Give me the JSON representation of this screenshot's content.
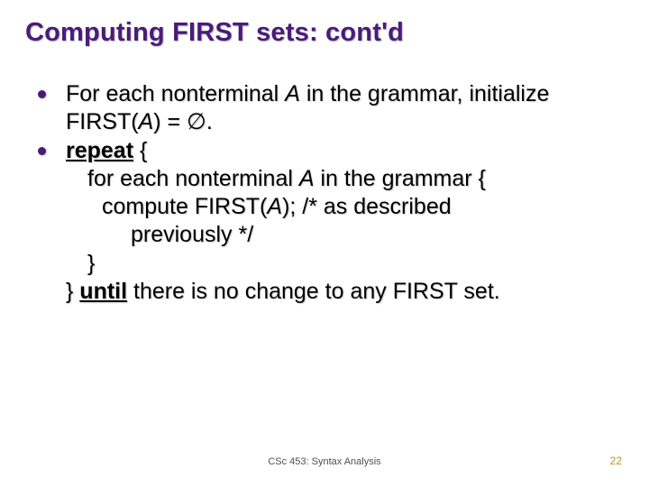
{
  "title": "Computing FIRST sets: cont'd",
  "b1": {
    "p1": "For each nonterminal ",
    "A1": "A",
    "p2": " in the grammar, initialize FIRST(",
    "A2": "A",
    "p3": ") = ∅."
  },
  "b2": {
    "repeat": "repeat",
    "brace_open": " {",
    "line_for_p1": "for each nonterminal ",
    "line_for_A": "A",
    "line_for_p2": " in the grammar {",
    "line_compute_p1": "compute FIRST(",
    "line_compute_A": "A",
    "line_compute_p2": ");    /* as described",
    "line_prev": "previously */",
    "brace_close_inner": "}",
    "brace_close_outer": "} ",
    "until": "until",
    "tail": " there is no change to any FIRST set."
  },
  "footer": {
    "center": "CSc 453: Syntax Analysis",
    "right": "22"
  }
}
